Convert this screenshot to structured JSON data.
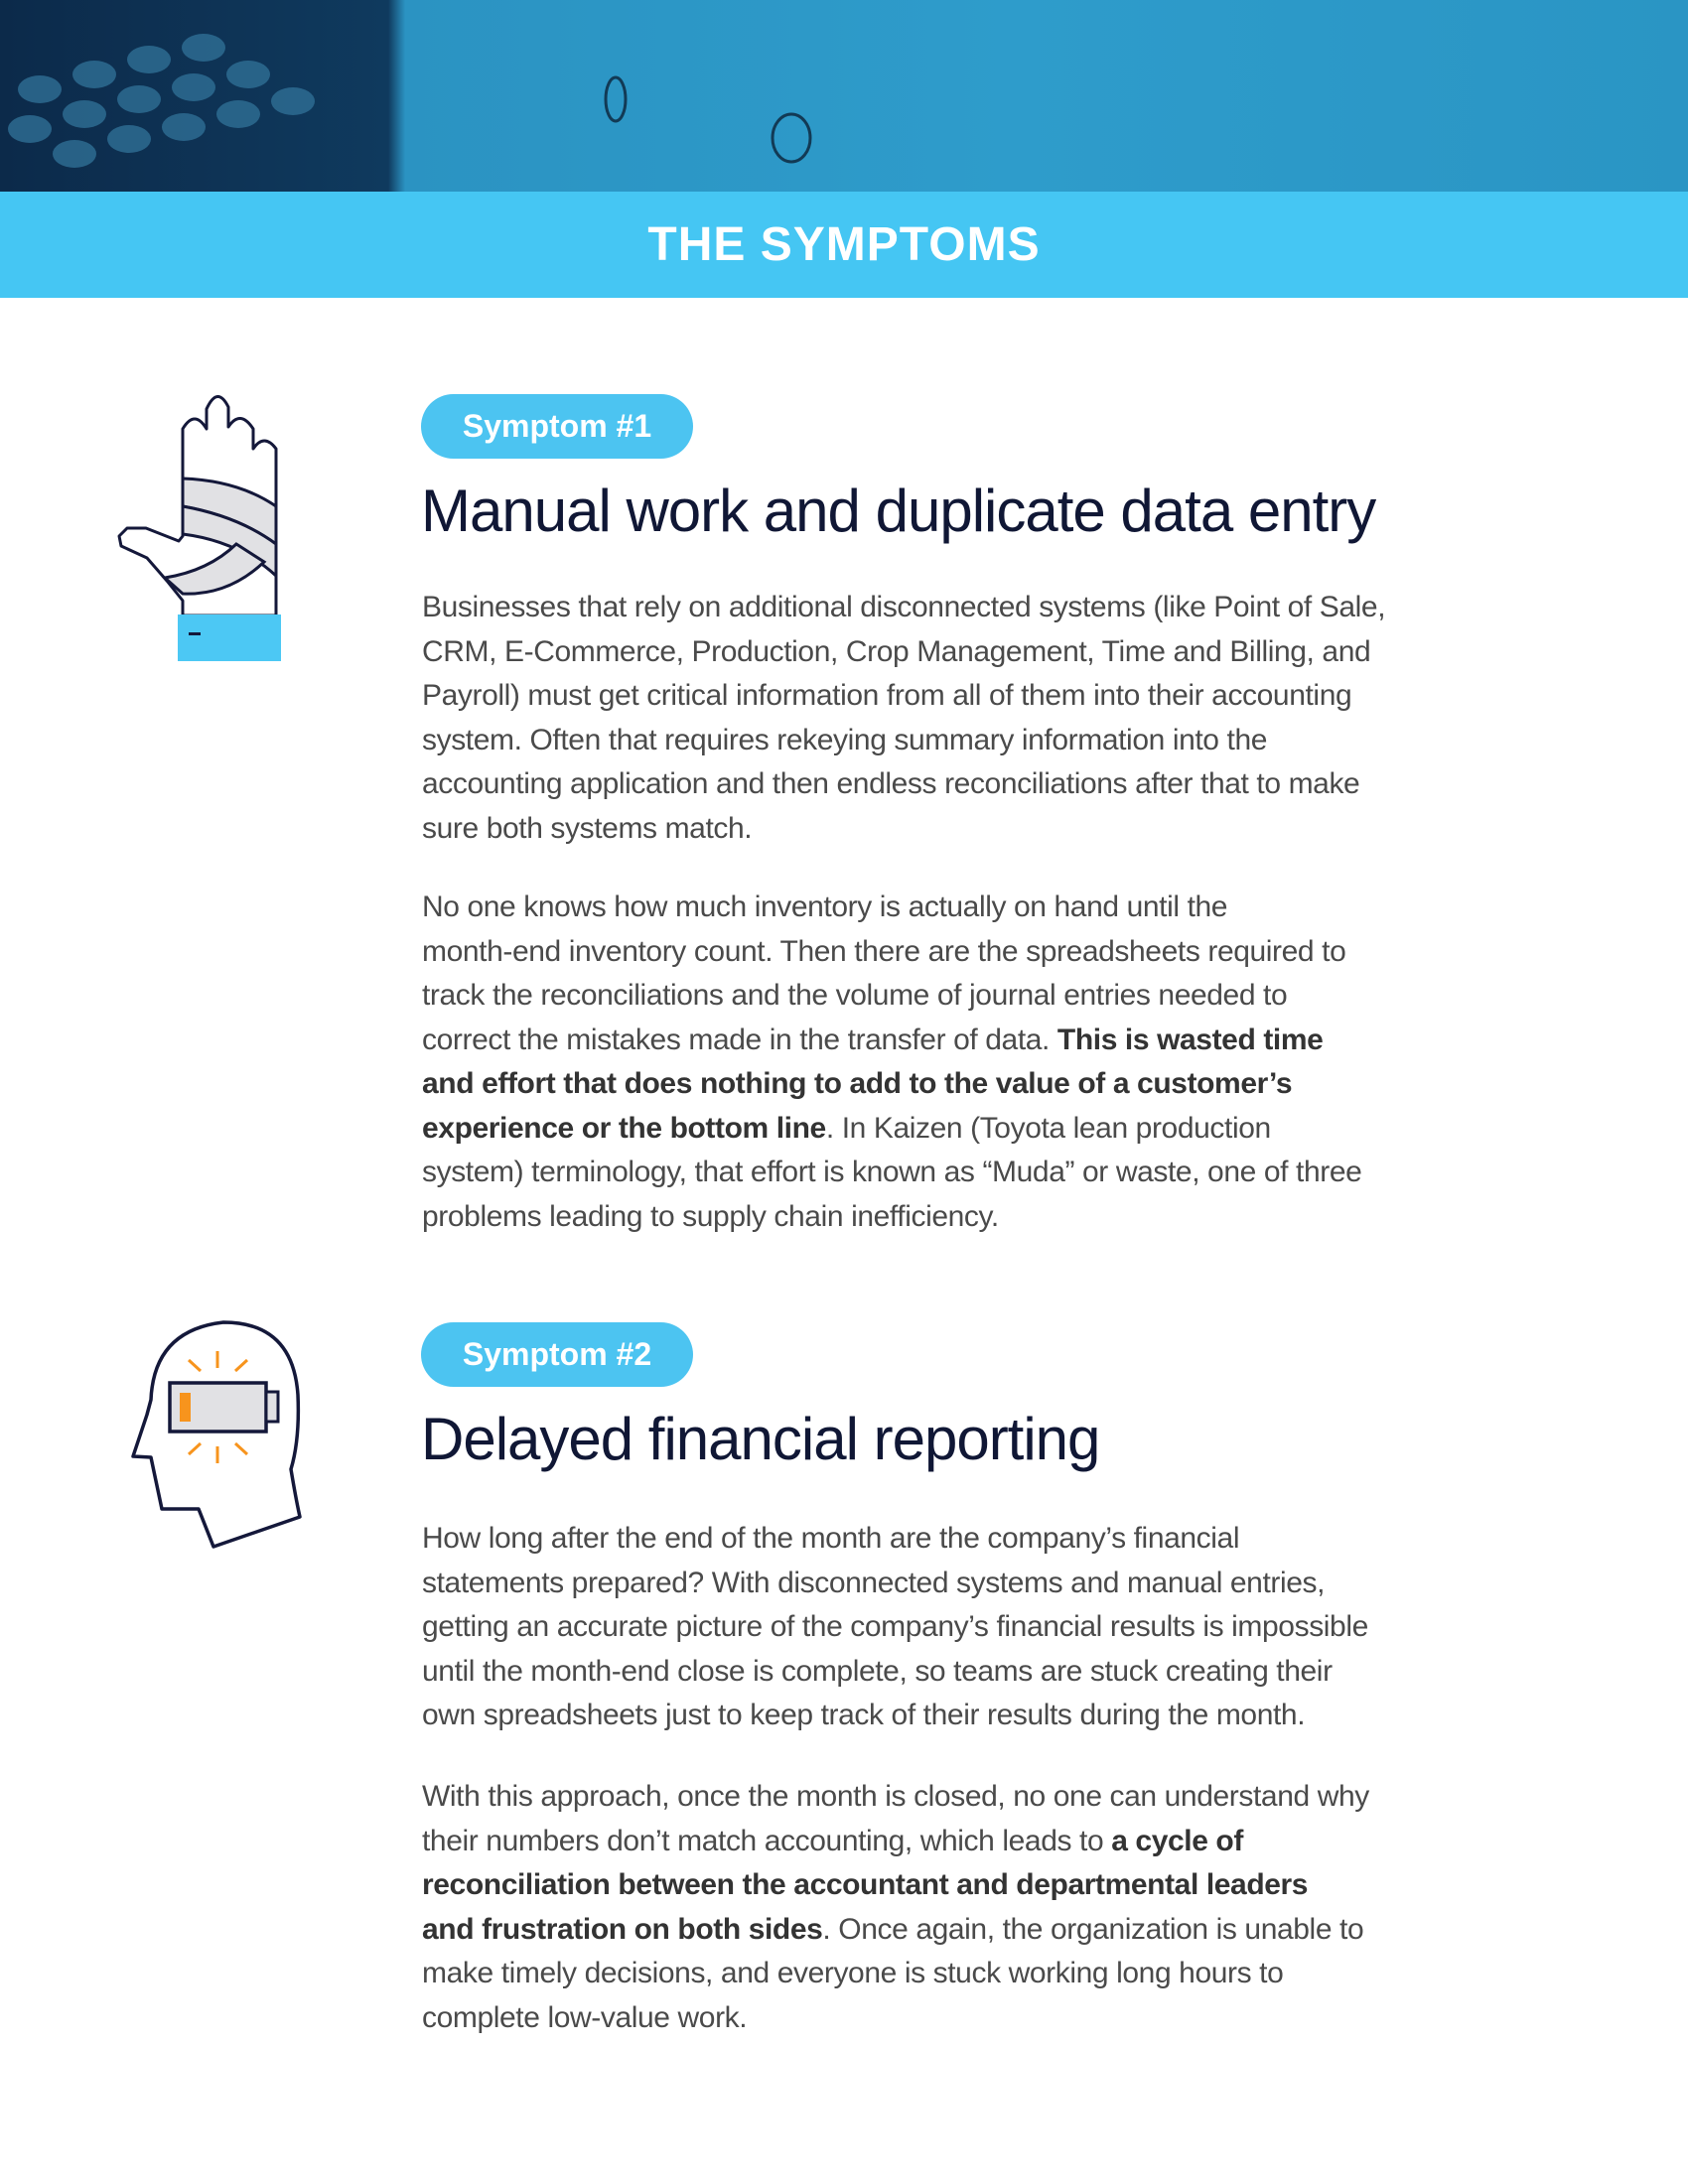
{
  "header": {
    "title": "THE SYMPTOMS"
  },
  "colors": {
    "accent": "#45c6f3",
    "badge": "#4cc4f1",
    "title": "#101735",
    "body": "#4a4a4a",
    "warning": "#f7941d"
  },
  "symptoms": [
    {
      "badge": "Symptom #1",
      "title": "Manual work and duplicate data entry",
      "icon": "bandaged-hand-icon",
      "paragraphs": [
        [
          [
            {
              "t": "Businesses that rely on additional disconnected systems (like Point of Sale,"
            }
          ],
          [
            {
              "t": "CRM, E-Commerce, Production, Crop Management, Time and Billing, and"
            }
          ],
          [
            {
              "t": "Payroll) must get critical information from all of them into their accounting"
            }
          ],
          [
            {
              "t": "system. Often that requires rekeying summary information into the"
            }
          ],
          [
            {
              "t": "accounting application and then endless reconciliations after that to make"
            }
          ],
          [
            {
              "t": "sure both systems match."
            }
          ]
        ],
        [
          [
            {
              "t": "No one knows how much inventory is actually on hand until the"
            }
          ],
          [
            {
              "t": "month-end inventory count. Then there are the spreadsheets required to"
            }
          ],
          [
            {
              "t": "track the reconciliations and the volume of journal entries needed to"
            }
          ],
          [
            {
              "t": "correct the mistakes made in the transfer of data. "
            },
            {
              "t": "This is wasted time",
              "b": true
            }
          ],
          [
            {
              "t": "and effort that does nothing to add to the value of a customer’s",
              "b": true
            }
          ],
          [
            {
              "t": "experience or the bottom line",
              "b": true
            },
            {
              "t": ". In Kaizen (Toyota lean production"
            }
          ],
          [
            {
              "t": "system) terminology, that effort is known as “Muda” or waste, one of three"
            }
          ],
          [
            {
              "t": "problems leading to supply chain inefficiency."
            }
          ]
        ]
      ]
    },
    {
      "badge": "Symptom #2",
      "title": "Delayed financial reporting",
      "icon": "head-low-battery-icon",
      "paragraphs": [
        [
          [
            {
              "t": "How long after the end of the month are the company’s financial"
            }
          ],
          [
            {
              "t": "statements prepared? With disconnected systems and manual entries,"
            }
          ],
          [
            {
              "t": "getting an accurate picture of the company’s financial results is impossible"
            }
          ],
          [
            {
              "t": "until the month-end close is complete, so teams are stuck creating their"
            }
          ],
          [
            {
              "t": "own spreadsheets just to keep track of their results during the month."
            }
          ]
        ],
        [
          [
            {
              "t": "With this approach, once the month is closed, no one can understand why"
            }
          ],
          [
            {
              "t": "their numbers don’t match accounting, which leads to "
            },
            {
              "t": "a cycle of",
              "b": true
            }
          ],
          [
            {
              "t": "reconciliation between the accountant and departmental leaders",
              "b": true
            }
          ],
          [
            {
              "t": "and frustration on both sides",
              "b": true
            },
            {
              "t": ". Once again, the organization is unable to"
            }
          ],
          [
            {
              "t": "make timely decisions, and everyone is stuck working long hours to"
            }
          ],
          [
            {
              "t": "complete low-value work."
            }
          ]
        ]
      ]
    }
  ]
}
